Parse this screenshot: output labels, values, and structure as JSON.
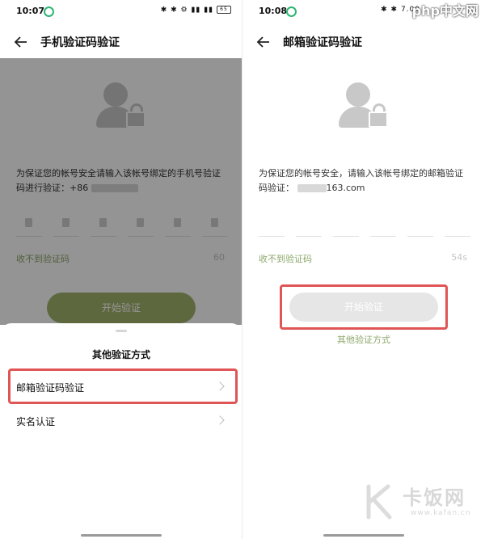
{
  "left": {
    "status_time": "10:07",
    "status_icons": "✱ ✱ ⚙ ▮▮ ▮▮",
    "battery": "65",
    "title": "手机验证码验证",
    "description": "为保证您的帐号安全请输入该帐号绑定的手机号验证码进行验证：+86",
    "resend": "收不到验证码",
    "timer": "60",
    "verify_button": "开始验证",
    "sheet": {
      "title": "其他验证方式",
      "items": [
        {
          "label": "邮箱验证码验证"
        },
        {
          "label": "实名认证"
        }
      ]
    }
  },
  "right": {
    "status_time": "10:08",
    "status_icons": "✱ ✱ 7.00",
    "title": "邮箱验证码验证",
    "description": "为保证您的帐号安全，请输入该帐号绑定的邮箱验证码验证：",
    "email_suffix": "163.com",
    "resend": "收不到验证码",
    "timer": "54s",
    "verify_button": "开始验证",
    "other_methods": "其他验证方式"
  },
  "watermarks": {
    "top": "php中文网",
    "bottom_text": "卡饭网",
    "bottom_url": "www.kafan.cn"
  }
}
